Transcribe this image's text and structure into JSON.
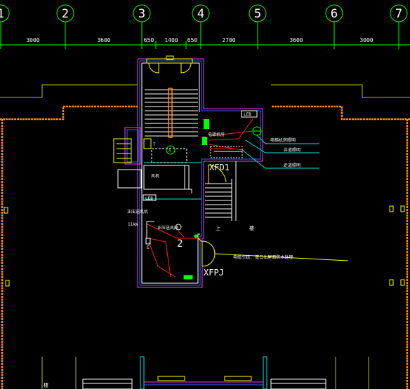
{
  "grid_axes": [
    "1",
    "2",
    "3",
    "4",
    "5",
    "6",
    "7"
  ],
  "dimensions": [
    "3000",
    "3600",
    "650",
    "1400",
    "650",
    "2700",
    "3600",
    "3000"
  ],
  "labels": {
    "xfd1": "XFD1",
    "xfpj": "XFPJ",
    "num_2": "2",
    "ldb_top": "LEB",
    "ldb_left": "LEB",
    "a_mark": "A",
    "t_mark": "T",
    "e_mark": "E",
    "shang": "上",
    "lou": "楼",
    "dian_ti_ji_fang": "电梯机房",
    "feng_ji": "风机",
    "jia_ya_song_feng_ji": "正压送风机",
    "power_11kw": "11kW",
    "jia_ya_fa": "正压送风阀",
    "elevator_pit_light": "电梯机房照明",
    "shaft_light": "井道照明",
    "corridor_light": "走道照明",
    "cable_note": "电缆引线, 管口出屋面防水处理",
    "bottom_lou": "楼"
  },
  "colors": {
    "grid": "#00ff00",
    "wall": "#ffffff",
    "orange": "#ff8c00",
    "yellow": "#ffff00",
    "cyan": "#00e5e5",
    "magenta": "#ff33ff",
    "blue": "#3366ff",
    "red": "#ff2020",
    "olive": "#b8b800"
  }
}
